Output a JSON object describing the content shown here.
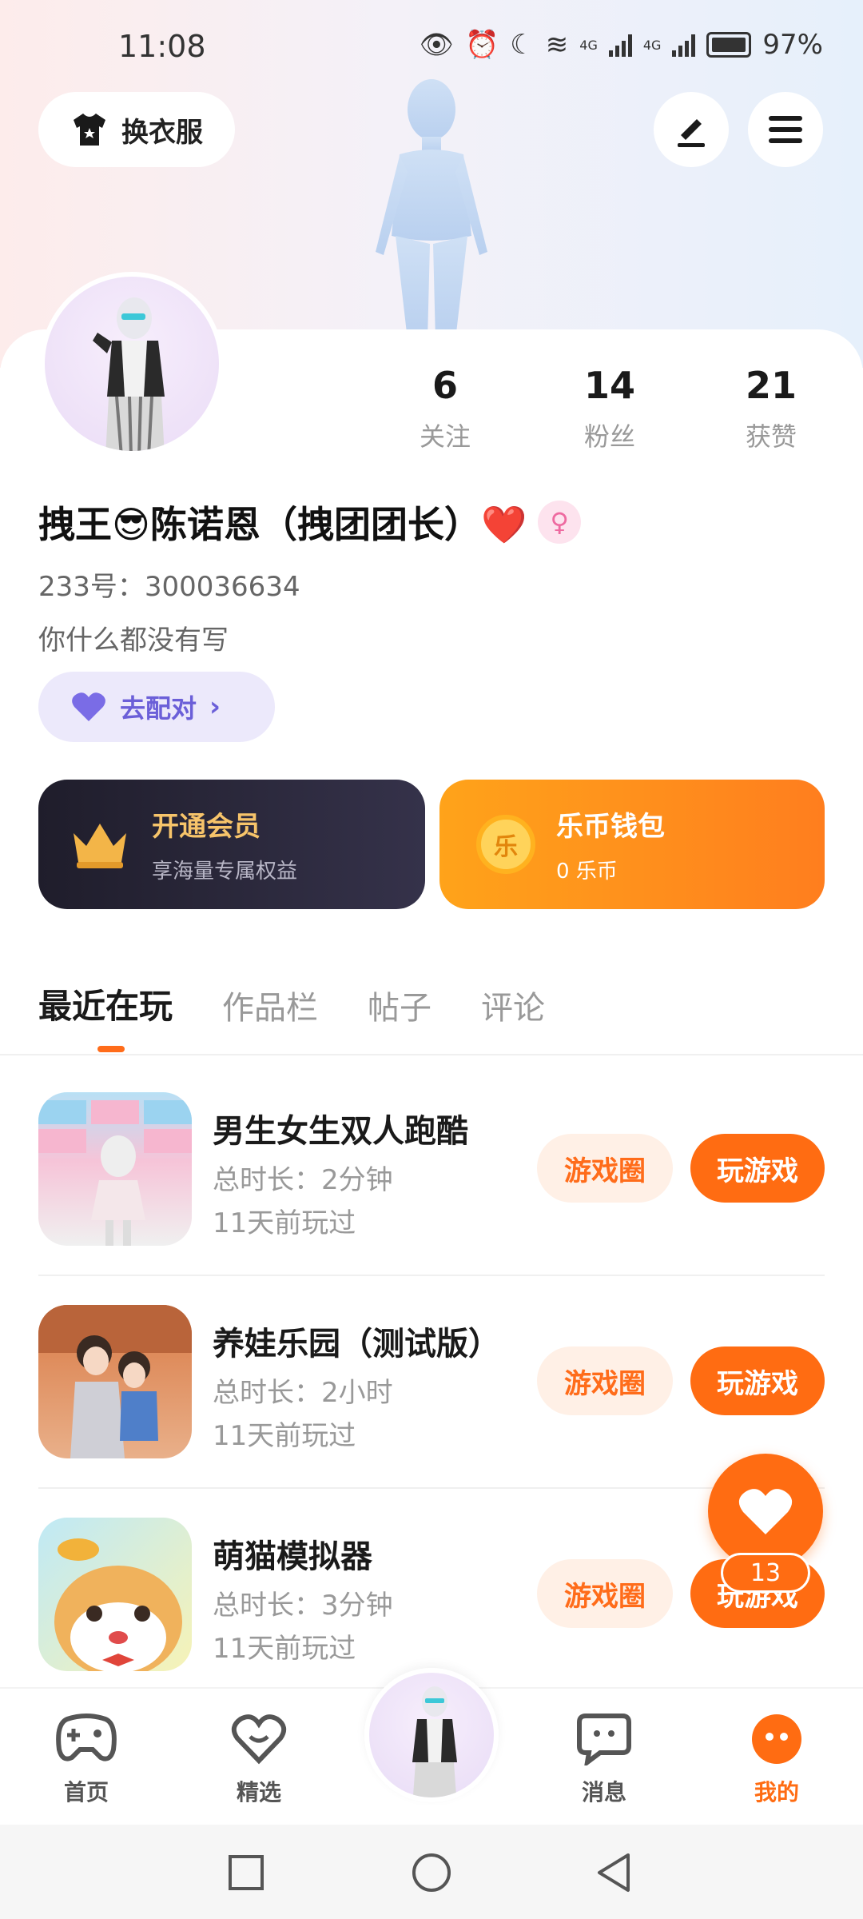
{
  "status_bar": {
    "time": "11:08",
    "network_labels": [
      "4G",
      "4G"
    ],
    "battery": "97%"
  },
  "header": {
    "outfit_label": "换衣服"
  },
  "profile": {
    "username": "拽王😎陈诺恩（拽团团长）❤️",
    "uid": "233号：300036634",
    "bio": "你什么都没有写",
    "match_label": "去配对",
    "stats": [
      {
        "value": "6",
        "label": "关注"
      },
      {
        "value": "14",
        "label": "粉丝"
      },
      {
        "value": "21",
        "label": "获赞"
      }
    ]
  },
  "cards": {
    "member": {
      "title": "开通会员",
      "subtitle": "享海量专属权益"
    },
    "wallet": {
      "coin_glyph": "乐",
      "title": "乐币钱包",
      "subtitle": "0 乐币"
    }
  },
  "tabs": [
    "最近在玩",
    "作品栏",
    "帖子",
    "评论"
  ],
  "games": [
    {
      "name": "男生女生双人跑酷",
      "duration": "总时长：2分钟",
      "last_played": "11天前玩过",
      "circle_label": "游戏圈",
      "play_label": "玩游戏"
    },
    {
      "name": "养娃乐园（测试版）",
      "duration": "总时长：2小时",
      "last_played": "11天前玩过",
      "circle_label": "游戏圈",
      "play_label": "玩游戏"
    },
    {
      "name": "萌猫模拟器",
      "duration": "总时长：3分钟",
      "last_played": "11天前玩过",
      "circle_label": "游戏圈",
      "play_label": "玩游戏"
    }
  ],
  "fab": {
    "count": "13"
  },
  "bottom_nav": [
    {
      "label": "首页"
    },
    {
      "label": "精选"
    },
    {
      "label": "消息"
    },
    {
      "label": "我的"
    }
  ],
  "colors": {
    "accent": "#ff6c12",
    "match": "#6b5fd8"
  }
}
